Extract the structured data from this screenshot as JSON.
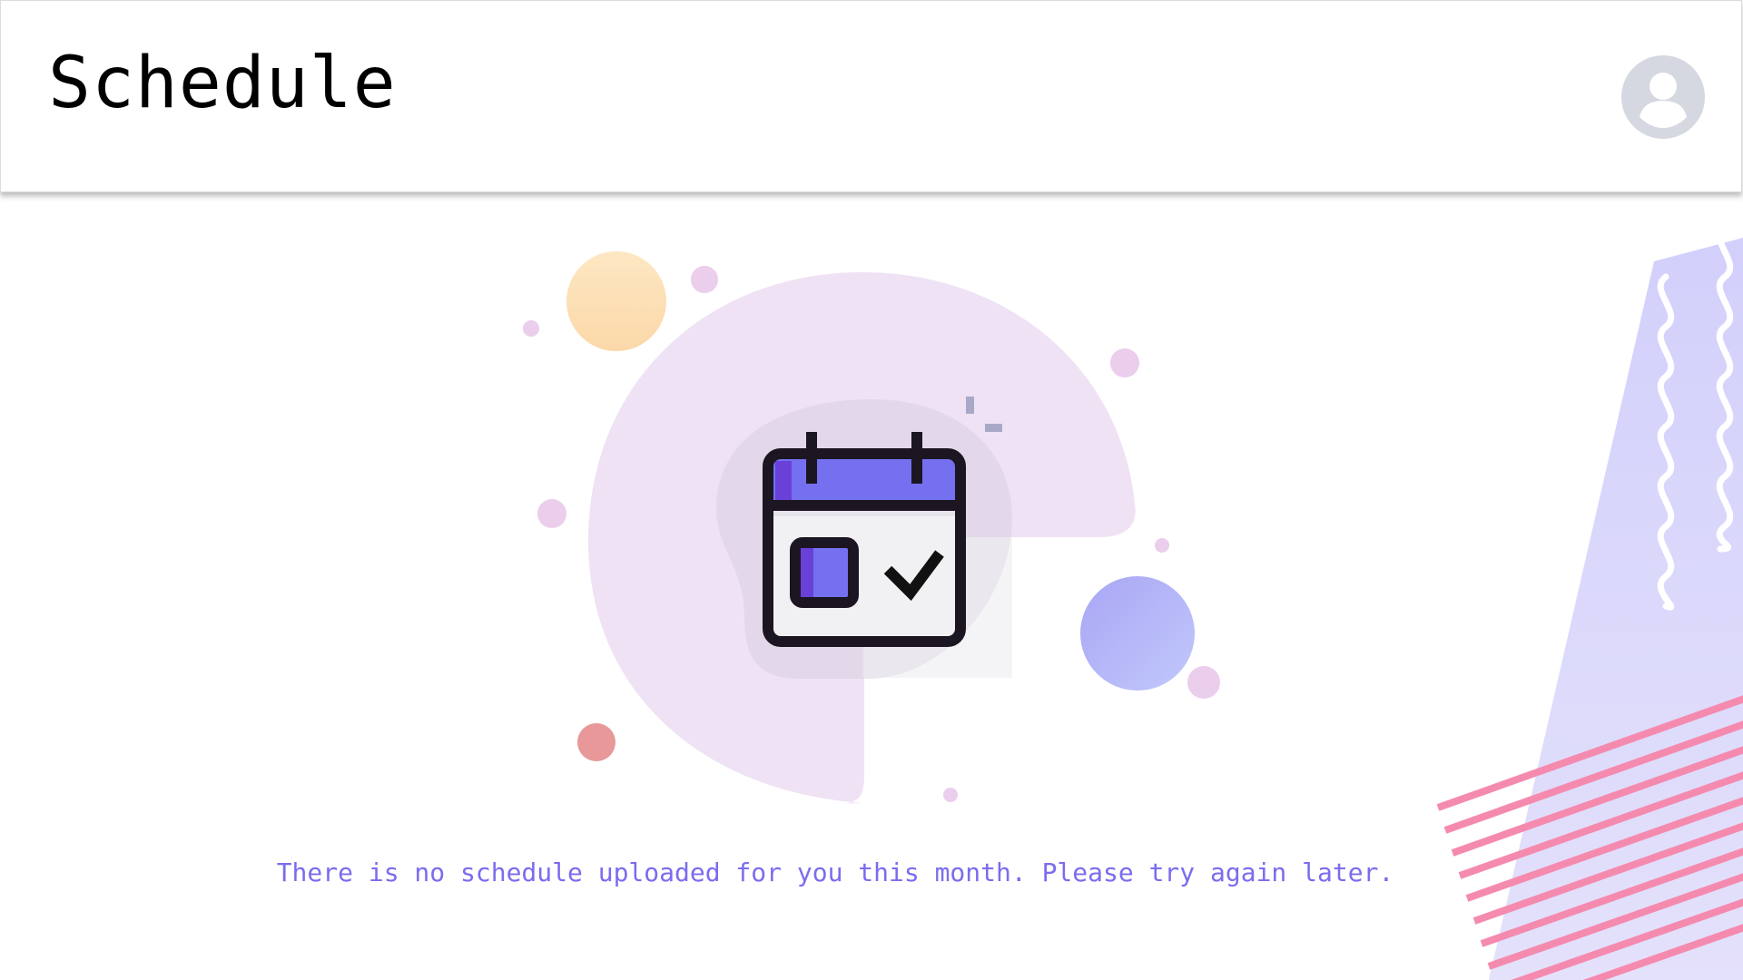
{
  "header": {
    "title": "Schedule",
    "avatar_icon": "user-avatar-icon"
  },
  "empty_state": {
    "illustration_icon": "calendar-check-icon",
    "message": "There is no schedule uploaded for you this month. Please try again later."
  },
  "colors": {
    "accent": "#7a6cf0",
    "calendar_header": "#7470f0",
    "blob": "#efe2f4",
    "stripes": "#f58aaf",
    "avatar": "#d5d8e0"
  }
}
